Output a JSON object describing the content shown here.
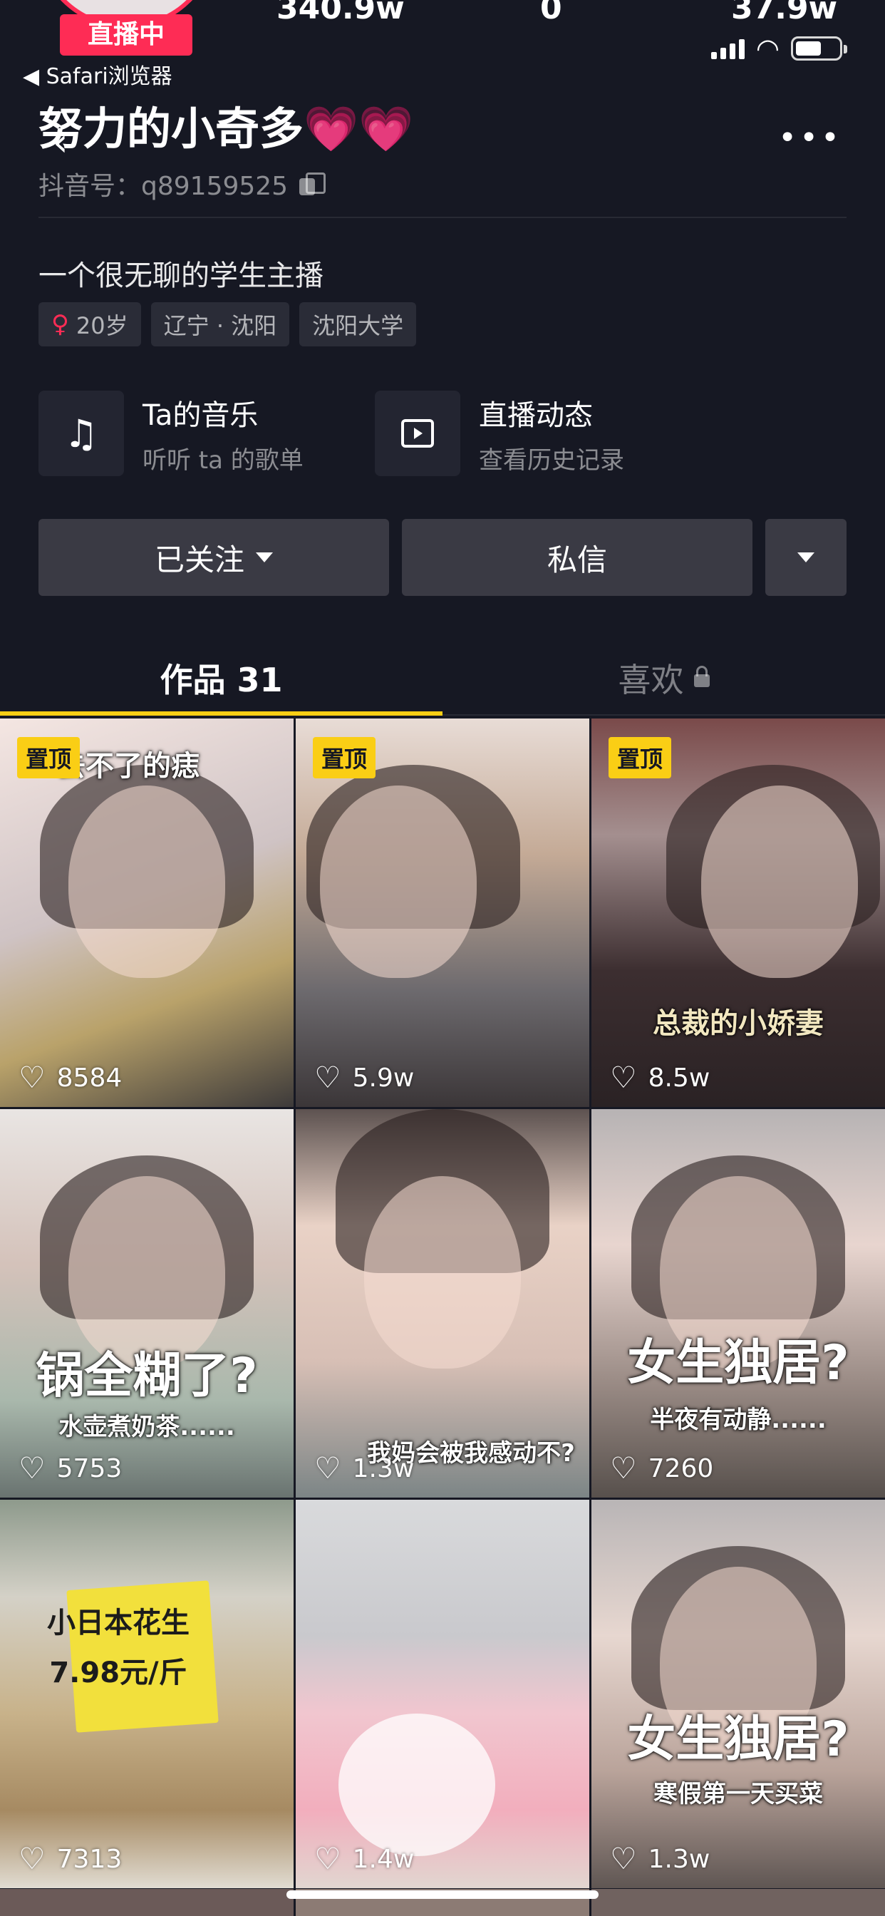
{
  "top_stats": {
    "live_badge": "直播中",
    "stat_1": "340.9w",
    "stat_2": "0",
    "stat_3": "37.9w"
  },
  "status_bar": {
    "back_app": "◀ Safari浏览器"
  },
  "profile": {
    "nickname": "努力的小奇多💗💗",
    "douyin_id": "抖音号：q89159525",
    "bio": "一个很无聊的学生主播",
    "tags": {
      "age": "20岁",
      "location": "辽宁 · 沈阳",
      "school": "沈阳大学"
    }
  },
  "entries": {
    "music_title": "Ta的音乐",
    "music_sub": "听听 ta 的歌单",
    "live_title": "直播动态",
    "live_sub": "查看历史记录"
  },
  "actions": {
    "follow": "已关注",
    "message": "私信"
  },
  "tabs": {
    "works": "作品 31",
    "likes": "喜欢"
  },
  "videos": [
    {
      "pinned": "置顶",
      "caption": "去不了的痣",
      "likes": "8584"
    },
    {
      "pinned": "置顶",
      "caption": "",
      "likes": "5.9w"
    },
    {
      "pinned": "置顶",
      "caption": "总裁的小娇妻",
      "likes": "8.5w"
    },
    {
      "caption_top": "锅全糊了?",
      "caption": "水壶煮奶茶......",
      "likes": "5753"
    },
    {
      "caption": "我妈会被我感动不?",
      "likes": "1.3w"
    },
    {
      "caption_top": "女生独居?",
      "caption": "半夜有动静......",
      "likes": "7260"
    },
    {
      "caption_top": "小日本花生",
      "caption": "7.98元/斤",
      "likes": "7313"
    },
    {
      "caption": "",
      "likes": "1.4w"
    },
    {
      "caption_top": "女生独居?",
      "caption": "寒假第一天买菜",
      "likes": "1.3w"
    }
  ],
  "colors": {
    "background": "#161823",
    "accent_yellow": "#face15",
    "accent_pink": "#fe2c55"
  }
}
